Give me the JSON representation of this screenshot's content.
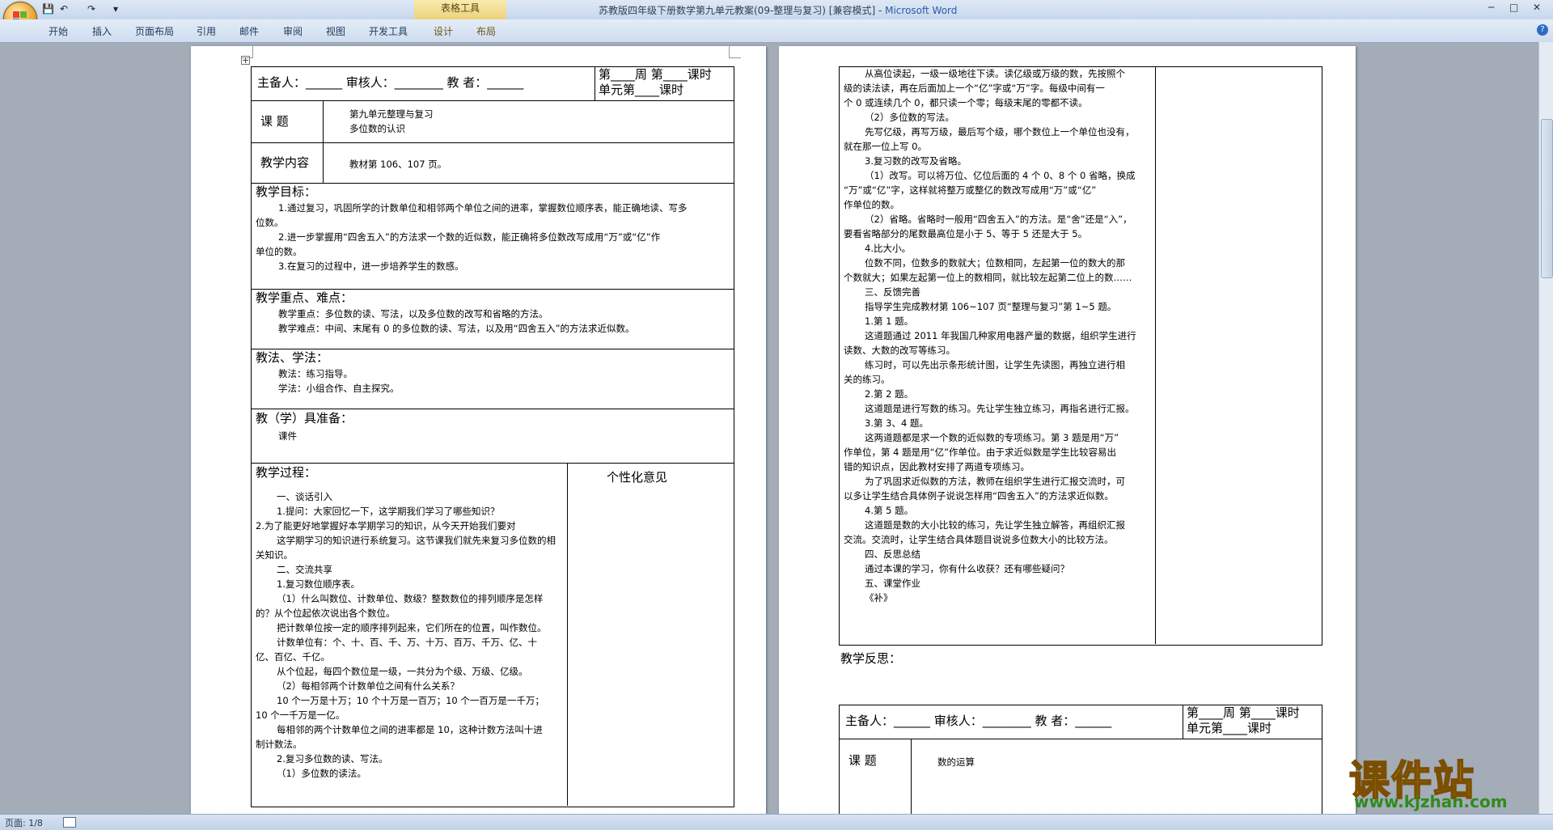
{
  "window": {
    "title_doc": "苏教版四年级下册数学第九单元教案(09-整理与复习) [兼容模式] - ",
    "title_app": "Microsoft Word",
    "context_tab_group": "表格工具",
    "controls": [
      "─",
      "□",
      "✕"
    ]
  },
  "quick_access": {
    "save": "💾",
    "undo": "↶",
    "redo": "↷",
    "more": "▾"
  },
  "ribbon_tabs": [
    "开始",
    "插入",
    "页面布局",
    "引用",
    "邮件",
    "审阅",
    "视图",
    "开发工具",
    "设计",
    "布局"
  ],
  "statusbar": {
    "page": "页面: 1/8"
  },
  "watermark": {
    "big": "课件站",
    "small": "www.kjzhan.com"
  },
  "left_page": {
    "header_row": {
      "left": "主备人：______ 审核人：________ 教 者：______",
      "right1": "第____周 第____课时",
      "right2": "单元第____课时"
    },
    "topic_label": "课 题",
    "topic_lines": [
      "第九单元整理与复习",
      "多位数的认识"
    ],
    "content_label": "教学内容",
    "content_value": "教材第 106、107 页。",
    "goals_label": "教学目标：",
    "goals_lines": [
      "1.通过复习，巩固所学的计数单位和相邻两个单位之间的进率，掌握数位顺序表，能正确地读、写多",
      "位数。",
      "2.进一步掌握用“四舍五入”的方法求一个数的近似数，能正确将多位数改写成用“万”或“亿”作",
      "单位的数。",
      "3.在复习的过程中，进一步培养学生的数感。"
    ],
    "keypoints_label": "教学重点、难点：",
    "keypoints_lines": [
      "教学重点：多位数的读、写法，以及多位数的改写和省略的方法。",
      "教学难点：中间、末尾有 0 的多位数的读、写法，以及用“四舍五入”的方法求近似数。"
    ],
    "methods_label": "教法、学法：",
    "methods_lines": [
      "教法：练习指导。",
      "学法：小组合作、自主探究。"
    ],
    "prep_label": "教（学）具准备：",
    "prep_value": "课件",
    "process_label": "教学过程：",
    "opinion_label": "个性化意见",
    "process_lines": [
      "一、谈话引入",
      "1.提问：大家回忆一下，这学期我们学习了哪些知识？",
      "2.为了能更好地掌握好本学期学习的知识，从今天开始我们要对",
      "这学期学习的知识进行系统复习。这节课我们就先来复习多位数的相",
      "关知识。",
      "二、交流共享",
      "1.复习数位顺序表。",
      "（1）什么叫数位、计数单位、数级？整数数位的排列顺序是怎样",
      "的？从个位起依次说出各个数位。",
      "把计数单位按一定的顺序排列起来，它们所在的位置，叫作数位。",
      "计数单位有：个、十、百、千、万、十万、百万、千万、亿、十",
      "亿、百亿、千亿。",
      "从个位起，每四个数位是一级，一共分为个级、万级、亿级。",
      "（2）每相邻两个计数单位之间有什么关系？",
      "10 个一万是十万；10 个十万是一百万；10 个一百万是一千万；",
      "10 个一千万是一亿。",
      "每相邻的两个计数单位之间的进率都是 10，这种计数方法叫十进",
      "制计数法。",
      "2.复习多位数的读、写法。",
      "（1）多位数的读法。"
    ]
  },
  "right_page": {
    "process_lines": [
      "从高位读起，一级一级地往下读。读亿级或万级的数，先按照个",
      "级的读法读，再在后面加上一个“亿”字或“万”字。每级中间有一",
      "个 0 或连续几个 0，都只读一个零；每级末尾的零都不读。",
      "（2）多位数的写法。",
      "先写亿级，再写万级，最后写个级，哪个数位上一个单位也没有，",
      "就在那一位上写 0。",
      "3.复习数的改写及省略。",
      "（1）改写。可以将万位、亿位后面的 4 个 0、8 个 0 省略，换成",
      "“万”或“亿”字，这样就将整万或整亿的数改写成用“万”或“亿”",
      "作单位的数。",
      "（2）省略。省略时一般用“四舍五入”的方法。是“舍”还是“入”，",
      "要看省略部分的尾数最高位是小于 5、等于 5 还是大于 5。",
      "4.比大小。",
      "位数不同，位数多的数就大；位数相同，左起第一位的数大的那",
      "个数就大；如果左起第一位上的数相同，就比较左起第二位上的数……",
      "三、反馈完善",
      "指导学生完成教材第 106~107 页“整理与复习”第 1~5 题。",
      "1.第 1 题。",
      "这道题通过 2011 年我国几种家用电器产量的数据，组织学生进行",
      "读数、大数的改写等练习。",
      "练习时，可以先出示条形统计图，让学生先读图，再独立进行相",
      "关的练习。",
      "2.第 2 题。",
      "这道题是进行写数的练习。先让学生独立练习，再指名进行汇报。",
      "3.第 3、4 题。",
      "这两道题都是求一个数的近似数的专项练习。第 3 题是用“万”",
      "作单位，第 4 题是用“亿”作单位。由于求近似数是学生比较容易出",
      "错的知识点，因此教材安排了两道专项练习。",
      "为了巩固求近似数的方法，教师在组织学生进行汇报交流时，可",
      "以多让学生结合具体例子说说怎样用“四舍五入”的方法求近似数。",
      "4.第 5 题。",
      "这道题是数的大小比较的练习，先让学生独立解答，再组织汇报",
      "交流。交流时，让学生结合具体题目说说多位数大小的比较方法。",
      "四、反思总结",
      "通过本课的学习，你有什么收获？还有哪些疑问？",
      "五、课堂作业",
      "《补》"
    ],
    "reflection_label": "教学反思：",
    "header_row": {
      "left": "主备人：______ 审核人：________ 教 者：______",
      "right1": "第____周 第____课时",
      "right2": "单元第____课时"
    },
    "topic_label": "课 题",
    "topic_value": "数的运算"
  }
}
